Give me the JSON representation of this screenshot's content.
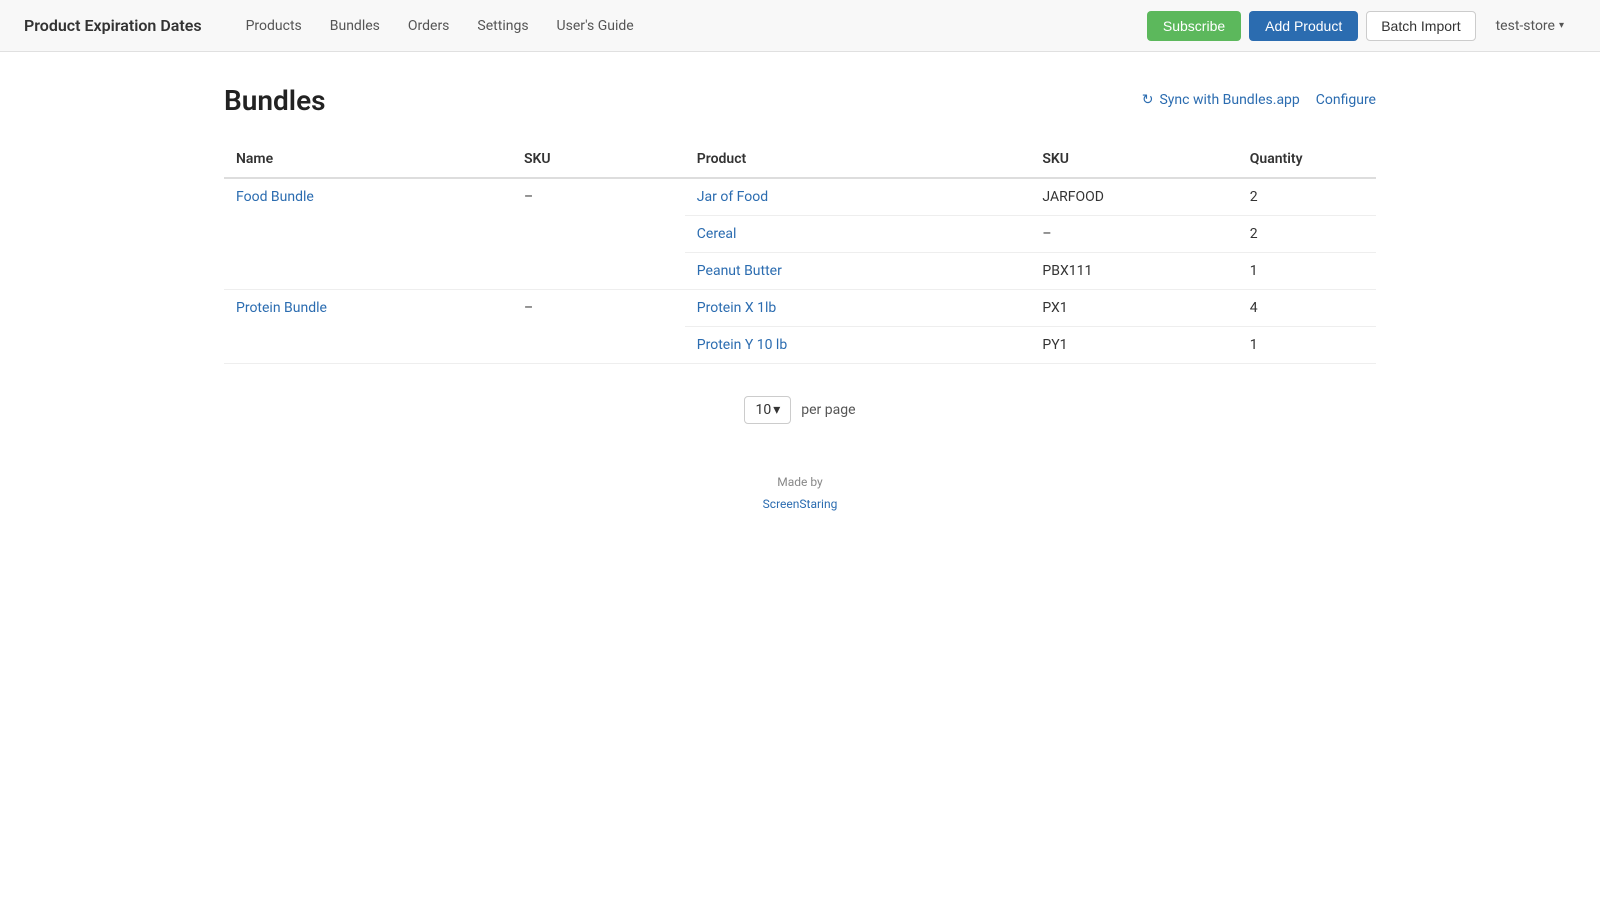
{
  "header": {
    "title": "Product Expiration Dates",
    "nav": [
      {
        "label": "Products",
        "id": "products"
      },
      {
        "label": "Bundles",
        "id": "bundles"
      },
      {
        "label": "Orders",
        "id": "orders"
      },
      {
        "label": "Settings",
        "id": "settings"
      },
      {
        "label": "User's Guide",
        "id": "users-guide"
      }
    ],
    "subscribe_label": "Subscribe",
    "add_product_label": "Add Product",
    "batch_import_label": "Batch Import",
    "store_name": "test-store"
  },
  "page": {
    "title": "Bundles",
    "sync_label": "Sync with Bundles.app",
    "configure_label": "Configure"
  },
  "table": {
    "columns": [
      {
        "label": "Name",
        "id": "name"
      },
      {
        "label": "SKU",
        "id": "sku"
      },
      {
        "label": "Product",
        "id": "product"
      },
      {
        "label": "SKU",
        "id": "product_sku"
      },
      {
        "label": "Quantity",
        "id": "quantity"
      }
    ],
    "bundles": [
      {
        "name": "Food Bundle",
        "name_link": true,
        "sku": "–",
        "products": [
          {
            "product": "Jar of Food",
            "product_link": true,
            "sku": "JARFOOD",
            "quantity": "2"
          },
          {
            "product": "Cereal",
            "product_link": true,
            "sku": "–",
            "quantity": "2"
          },
          {
            "product": "Peanut Butter",
            "product_link": true,
            "sku": "PBX111",
            "quantity": "1"
          }
        ]
      },
      {
        "name": "Protein Bundle",
        "name_link": true,
        "sku": "–",
        "products": [
          {
            "product": "Protein X 1lb",
            "product_link": true,
            "sku": "PX1",
            "quantity": "4"
          },
          {
            "product": "Protein Y 10 lb",
            "product_link": true,
            "sku": "PY1",
            "quantity": "1"
          }
        ]
      }
    ]
  },
  "pagination": {
    "per_page_value": "10",
    "per_page_label": "per page"
  },
  "footer": {
    "made_by_label": "Made by",
    "company_name": "ScreenStaring"
  }
}
